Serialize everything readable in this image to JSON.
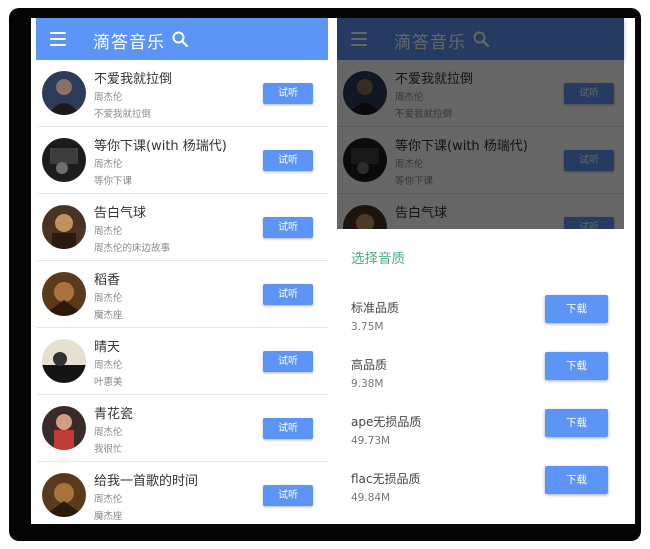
{
  "app": {
    "title": "滴答音乐"
  },
  "songs": [
    {
      "title": "不爱我就拉倒",
      "artist": "周杰伦",
      "album": "不爱我就拉倒",
      "button": "试听"
    },
    {
      "title": "等你下课(with 杨瑞代)",
      "artist": "周杰伦",
      "album": "等你下课",
      "button": "试听"
    },
    {
      "title": "告白气球",
      "artist": "周杰伦",
      "album": "周杰伦的床边故事",
      "button": "试听"
    },
    {
      "title": "稻香",
      "artist": "周杰伦",
      "album": "魔杰座",
      "button": "试听"
    },
    {
      "title": "晴天",
      "artist": "周杰伦",
      "album": "叶惠美",
      "button": "试听"
    },
    {
      "title": "青花瓷",
      "artist": "周杰伦",
      "album": "我很忙",
      "button": "试听"
    },
    {
      "title": "给我一首歌的时间",
      "artist": "周杰伦",
      "album": "魔杰座",
      "button": "试听"
    }
  ],
  "sheet": {
    "title": "选择音质",
    "options": [
      {
        "name": "标准品质",
        "size": "3.75M",
        "button": "下载"
      },
      {
        "name": "高品质",
        "size": "9.38M",
        "button": "下载"
      },
      {
        "name": "ape无损品质",
        "size": "49.73M",
        "button": "下载"
      },
      {
        "name": "flac无损品质",
        "size": "49.84M",
        "button": "下载"
      }
    ]
  },
  "colors": {
    "accent": "#5c95f5",
    "sheet_title": "#4caf7d",
    "frame": "#050505"
  },
  "icons": [
    "menu-icon",
    "search-icon",
    "album-cover"
  ]
}
